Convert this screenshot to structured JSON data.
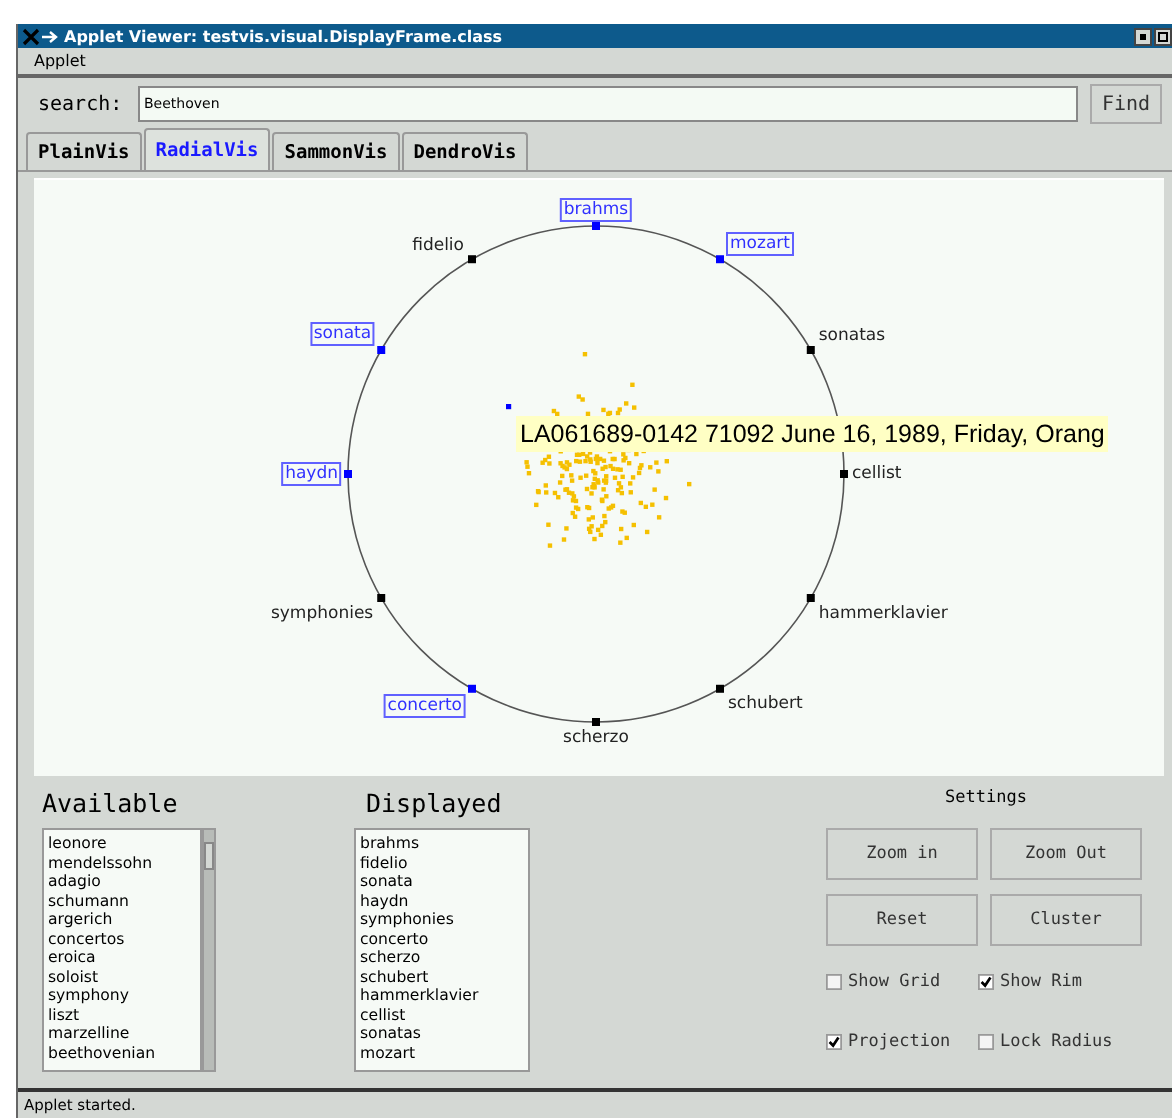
{
  "window": {
    "title": "Applet Viewer: testvis.visual.DisplayFrame.class"
  },
  "menu": [
    "Applet"
  ],
  "search": {
    "label": "search:",
    "value": "Beethoven",
    "button": "Find"
  },
  "tabs": [
    {
      "label": "PlainVis",
      "selected": false
    },
    {
      "label": "RadialVis",
      "selected": true
    },
    {
      "label": "SammonVis",
      "selected": false
    },
    {
      "label": "DendroVis",
      "selected": false
    }
  ],
  "radial": {
    "right_arc": [
      {
        "label": "brahms",
        "selected": true
      },
      {
        "label": "mozart",
        "selected": true
      },
      {
        "label": "sonatas",
        "selected": false
      },
      {
        "label": "cellist",
        "selected": false
      },
      {
        "label": "hammerklavier",
        "selected": false
      },
      {
        "label": "schubert",
        "selected": false
      },
      {
        "label": "scherzo",
        "selected": false
      }
    ],
    "left_arc": [
      {
        "label": "fidelio",
        "selected": false
      },
      {
        "label": "sonata",
        "selected": true
      },
      {
        "label": "haydn",
        "selected": true
      },
      {
        "label": "symphonies",
        "selected": false
      },
      {
        "label": "concerto",
        "selected": true
      }
    ],
    "tooltip": "LA061689-0142 71092 June 16, 1989, Friday, Orang"
  },
  "available": {
    "title": "Available",
    "items": [
      "leonore",
      "mendelssohn",
      "adagio",
      "schumann",
      "argerich",
      "concertos",
      "eroica",
      "soloist",
      "symphony",
      "liszt",
      "marzelline",
      "beethovenian"
    ]
  },
  "displayed": {
    "title": "Displayed",
    "items": [
      "brahms",
      "fidelio",
      "sonata",
      "haydn",
      "symphonies",
      "concerto",
      "scherzo",
      "schubert",
      "hammerklavier",
      "cellist",
      "sonatas",
      "mozart"
    ]
  },
  "settings": {
    "title": "Settings",
    "buttons": [
      "Zoom in",
      "Zoom Out",
      "Reset",
      "Cluster"
    ],
    "options": [
      {
        "label": "Show Grid",
        "checked": false
      },
      {
        "label": "Show Rim",
        "checked": true
      },
      {
        "label": "Projection",
        "checked": true
      },
      {
        "label": "Lock Radius",
        "checked": false
      }
    ]
  },
  "status_bar": "Applet started."
}
